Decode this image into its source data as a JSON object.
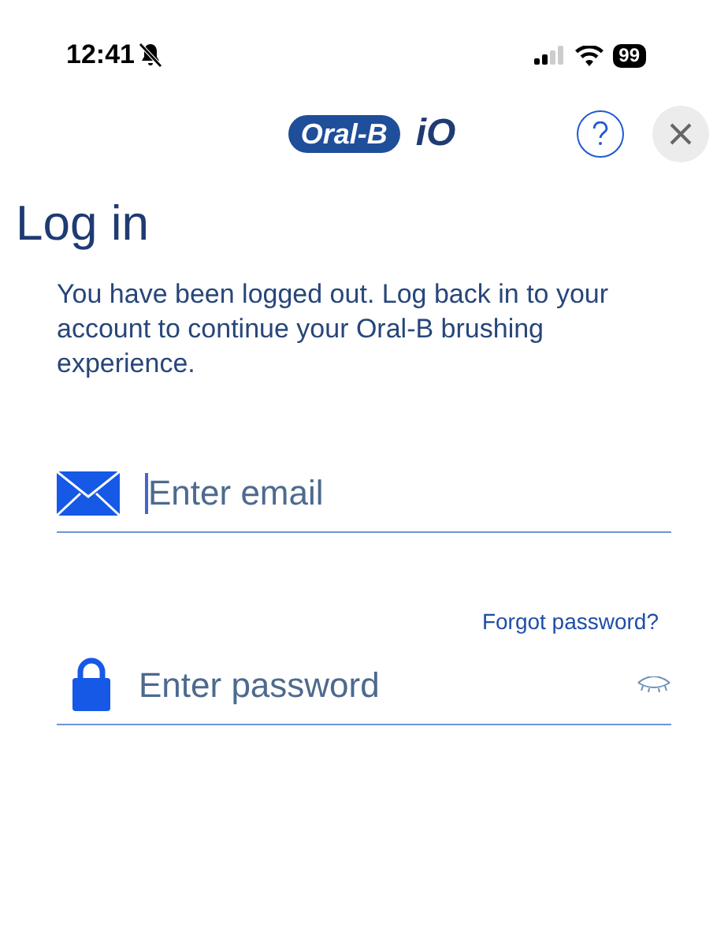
{
  "status_bar": {
    "time": "12:41",
    "battery": "99"
  },
  "header": {
    "logo_brand": "Oral-B",
    "logo_suffix": "iO"
  },
  "title": "Log in",
  "message": "You have been logged out. Log back in to your account to continue your Oral-B brushing experience.",
  "email_field": {
    "placeholder": "Enter email",
    "focused": true
  },
  "forgot_link": "Forgot password?",
  "password_field": {
    "placeholder": "Enter password"
  }
}
